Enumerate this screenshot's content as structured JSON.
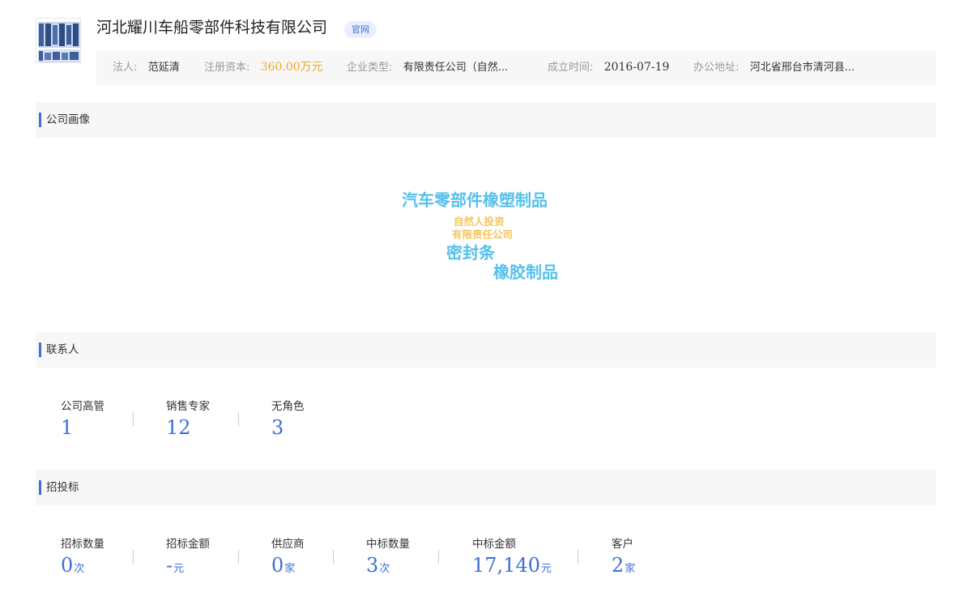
{
  "colors": {
    "accent_blue": "#3d6fd6",
    "capital_orange": "#f0a72b",
    "cloud_blue": "#56c0ec",
    "cloud_yellow": "#f5c65a",
    "section_bg": "#f7f7f7"
  },
  "company": {
    "name": "河北耀川车船零部件科技有限公司",
    "site_badge": "官网",
    "logo_icon": "company-seal-logo"
  },
  "info": {
    "legal_person_label": "法人:",
    "legal_person": "范延清",
    "capital_label": "注册资本:",
    "capital": "360.00万元",
    "type_label": "企业类型:",
    "type": "有限责任公司（自然...",
    "founded_label": "成立时间:",
    "founded": "2016-07-19",
    "address_label": "办公地址:",
    "address": "河北省邢台市清河县..."
  },
  "portrait": {
    "title": "公司画像",
    "keywords": [
      {
        "text": "汽车零部件橡塑制品",
        "color": "blue"
      },
      {
        "text": "自然人投资",
        "color": "yellow"
      },
      {
        "text": "有限责任公司",
        "color": "yellow"
      },
      {
        "text": "密封条",
        "color": "blue"
      },
      {
        "text": "橡胶制品",
        "color": "blue"
      }
    ]
  },
  "contacts": {
    "title": "联系人",
    "stats": [
      {
        "label": "公司高管",
        "value": "1"
      },
      {
        "label": "销售专家",
        "value": "12"
      },
      {
        "label": "无角色",
        "value": "3"
      }
    ]
  },
  "bidding": {
    "title": "招投标",
    "stats": [
      {
        "label": "招标数量",
        "value": "0",
        "unit": "次"
      },
      {
        "label": "招标金额",
        "value": "-",
        "unit": "元"
      },
      {
        "label": "供应商",
        "value": "0",
        "unit": "家"
      },
      {
        "label": "中标数量",
        "value": "3",
        "unit": "次"
      },
      {
        "label": "中标金额",
        "value": "17,140",
        "unit": "元"
      },
      {
        "label": "客户",
        "value": "2",
        "unit": "家"
      }
    ]
  }
}
